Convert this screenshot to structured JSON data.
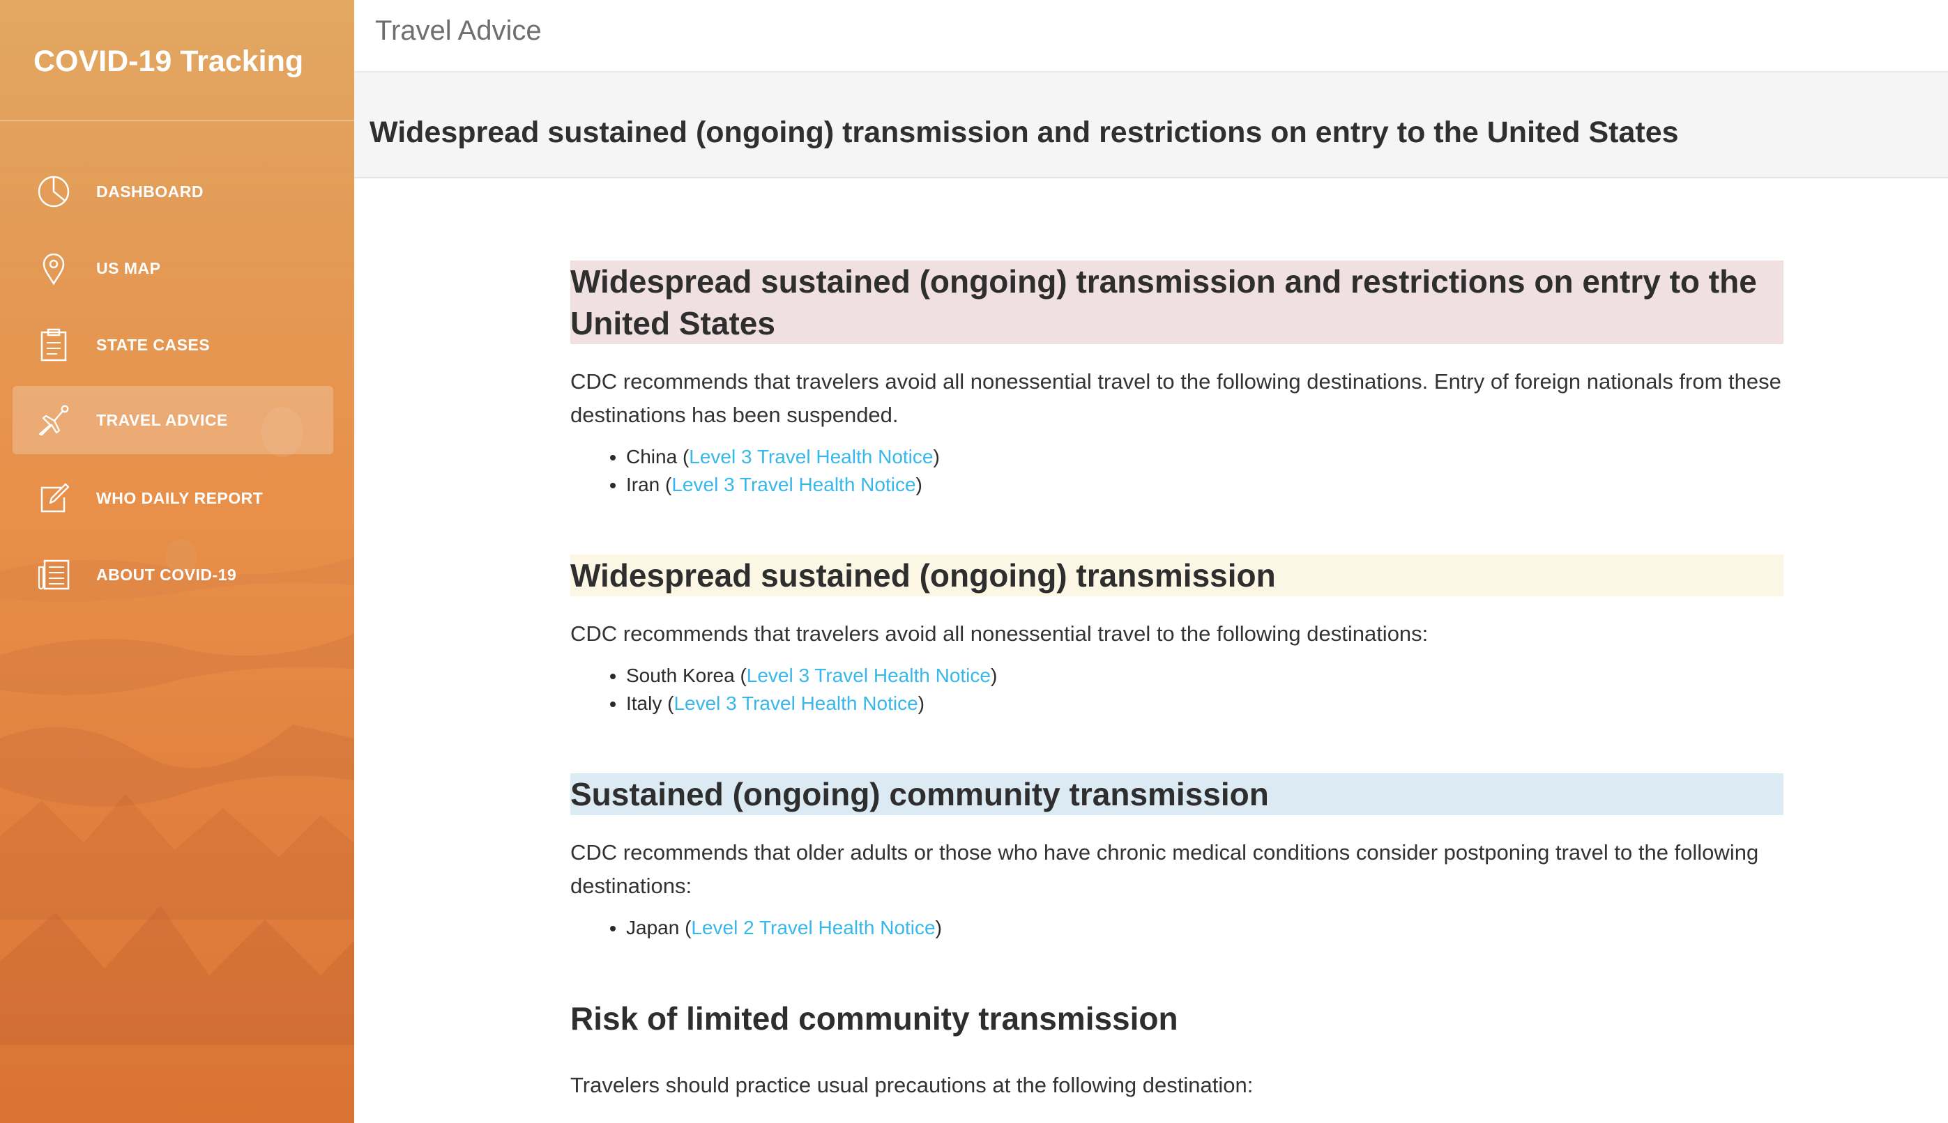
{
  "sidebar": {
    "brand": "COVID-19 Tracking",
    "items": [
      {
        "label": "DASHBOARD",
        "icon": "pie-chart-icon",
        "active": false
      },
      {
        "label": "US MAP",
        "icon": "map-pin-icon",
        "active": false
      },
      {
        "label": "STATE CASES",
        "icon": "clipboard-icon",
        "active": false
      },
      {
        "label": "TRAVEL ADVICE",
        "icon": "airplane-icon",
        "active": true
      },
      {
        "label": "WHO DAILY REPORT",
        "icon": "edit-icon",
        "active": false
      },
      {
        "label": "ABOUT COVID-19",
        "icon": "newspaper-icon",
        "active": false
      }
    ]
  },
  "topbar": {
    "title": "Travel Advice"
  },
  "header": {
    "title": "Widespread sustained (ongoing) transmission and restrictions on entry to the United States"
  },
  "sections": [
    {
      "heading": "Widespread sustained (ongoing) transmission and restrictions on entry to the United States",
      "description": "CDC recommends that travelers avoid all nonessential travel to the following destinations. Entry of foreign nationals from these destinations has been suspended.",
      "items": [
        {
          "country": "China",
          "link": "Level 3 Travel Health Notice"
        },
        {
          "country": "Iran",
          "link": "Level 3 Travel Health Notice"
        }
      ]
    },
    {
      "heading": "Widespread sustained (ongoing) transmission",
      "description": "CDC recommends that travelers avoid all nonessential travel to the following destinations:",
      "items": [
        {
          "country": "South Korea",
          "link": "Level 3 Travel Health Notice"
        },
        {
          "country": "Italy",
          "link": "Level 3 Travel Health Notice"
        }
      ]
    },
    {
      "heading": "Sustained (ongoing) community transmission",
      "description": "CDC recommends that older adults or those who have chronic medical conditions consider postponing travel to the following destinations:",
      "items": [
        {
          "country": "Japan",
          "link": "Level 2 Travel Health Notice"
        }
      ]
    },
    {
      "heading": "Risk of limited community transmission",
      "description": "Travelers should practice usual precautions at the following destination:",
      "items": []
    }
  ],
  "colors": {
    "sidebar_top": "#e2a862",
    "sidebar_bottom": "#e27a36",
    "link": "#37b7ea",
    "heading_red_bg": "#f1e0e1",
    "heading_yellow_bg": "#fcf7e5",
    "heading_blue_bg": "#dceaf3"
  }
}
